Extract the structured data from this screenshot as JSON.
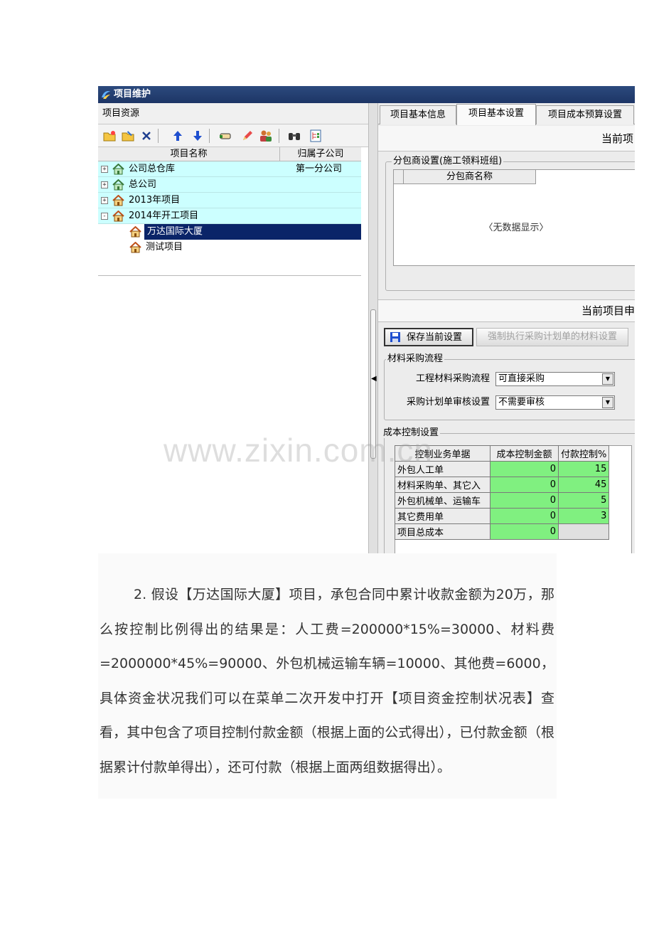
{
  "window": {
    "title": "项目维护"
  },
  "left_panel": {
    "header": "项目资源",
    "tree_columns": [
      "项目名称",
      "归属子公司"
    ],
    "tree_rows": [
      {
        "name": "公司总仓库",
        "subsidiary": "第一分公司",
        "expander": "+"
      },
      {
        "name": "总公司",
        "subsidiary": "",
        "expander": "+"
      },
      {
        "name": "2013年项目",
        "subsidiary": "",
        "expander": "+"
      },
      {
        "name": "2014年开工项目",
        "subsidiary": "",
        "expander": "-"
      },
      {
        "name": "万达国际大厦",
        "subsidiary": ""
      },
      {
        "name": "测试项目",
        "subsidiary": ""
      }
    ]
  },
  "right_panel": {
    "tabs": [
      "项目基本信息",
      "项目基本设置",
      "项目成本预算设置"
    ],
    "active_tab": "项目基本设置",
    "bar_top": "当前项",
    "subcontractor": {
      "legend": "分包商设置(施工领料班组)",
      "column": "分包商名称",
      "empty_text": "〈无数据显示〉"
    },
    "bar_mid": "当前项目申",
    "buttons": {
      "save": "保存当前设置",
      "force": "强制执行采购计划单的材料设置"
    },
    "material_flow": {
      "legend": "材料采购流程",
      "flow_label": "工程材料采购流程",
      "flow_value": "可直接采购",
      "audit_label": "采购计划单审核设置",
      "audit_value": "不需要审核"
    },
    "cost_control": {
      "legend": "成本控制设置",
      "columns": [
        "控制业务单据",
        "成本控制金额",
        "付款控制%"
      ],
      "rows": [
        {
          "doc": "外包人工单",
          "amount": "0",
          "pay": "15"
        },
        {
          "doc": "材料采购单、其它入",
          "amount": "0",
          "pay": "45"
        },
        {
          "doc": "外包机械单、运输车",
          "amount": "0",
          "pay": "5"
        },
        {
          "doc": "其它费用单",
          "amount": "0",
          "pay": "3"
        },
        {
          "doc": "项目总成本",
          "amount": "0",
          "pay": ""
        }
      ]
    }
  },
  "watermark": "www.zixin.com.cn",
  "paragraph": "2. 假设【万达国际大厦】项目，承包合同中累计收款金额为20万，那么按控制比例得出的结果是：人工费=200000*15%=30000、材料费=2000000*45%=90000、外包机械运输车辆=10000、其他费=6000，具体资金状况我们可以在菜单二次开发中打开【项目资金控制状况表】查看，其中包含了项目控制付款金额（根据上面的公式得出），已付款金额（根据累计付款单得出），还可付款（根据上面两组数据得出）。",
  "icons": {
    "toolbar": [
      "folder-new-icon",
      "folder-edit-icon",
      "delete-icon",
      "arrow-up-icon",
      "arrow-down-icon",
      "hand-icon",
      "pen-icon",
      "users-icon",
      "binoculars-icon",
      "tree-list-icon"
    ],
    "colors": {
      "titlebar": "#1d3566",
      "tree_highlight": "#ccffff",
      "selection": "#0a2468",
      "cost_cell": "#80f080"
    }
  }
}
